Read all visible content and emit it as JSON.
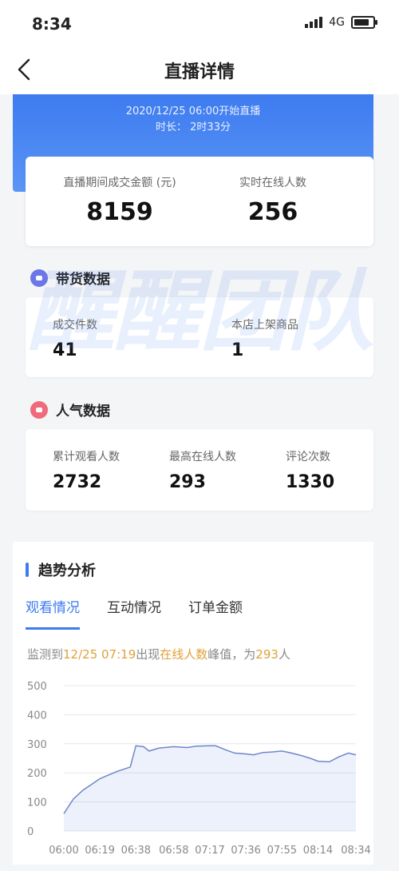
{
  "status": {
    "time": "8:34",
    "network": "4G"
  },
  "nav": {
    "title": "直播详情"
  },
  "banner": {
    "start": "2020/12/25 06:00开始直播",
    "duration": "时长： 2时33分"
  },
  "summary": {
    "gmv_label": "直播期间成交金额 (元)",
    "gmv_value": "8159",
    "online_label": "实时在线人数",
    "online_value": "256"
  },
  "goods": {
    "title": "带货数据",
    "orders_label": "成交件数",
    "orders_value": "41",
    "listed_label": "本店上架商品",
    "listed_value": "1"
  },
  "popularity": {
    "title": "人气数据",
    "viewers_label": "累计观看人数",
    "viewers_value": "2732",
    "peak_label": "最高在线人数",
    "peak_value": "293",
    "comments_label": "评论次数",
    "comments_value": "1330"
  },
  "trend": {
    "title": "趋势分析",
    "tabs": [
      "观看情况",
      "互动情况",
      "订单金额"
    ],
    "monitor": {
      "p1": "监测到",
      "time": "12/25 07:19",
      "p2": "出现",
      "metric": "在线人数",
      "p3": "峰值，为",
      "count": "293",
      "p4": "人"
    }
  },
  "watermark": "醒醒团队",
  "colors": {
    "accent": "#3d7bf0",
    "highlight": "#e0a13a"
  },
  "chart_data": {
    "type": "area",
    "x": [
      "06:00",
      "06:05",
      "06:10",
      "06:19",
      "06:28",
      "06:35",
      "06:38",
      "06:42",
      "06:45",
      "06:50",
      "06:58",
      "07:05",
      "07:10",
      "07:17",
      "07:20",
      "07:25",
      "07:30",
      "07:36",
      "07:40",
      "07:45",
      "07:50",
      "07:55",
      "08:00",
      "08:05",
      "08:10",
      "08:14",
      "08:20",
      "08:25",
      "08:30",
      "08:34"
    ],
    "values": [
      60,
      110,
      140,
      180,
      205,
      220,
      293,
      290,
      275,
      285,
      290,
      287,
      292,
      293,
      293,
      280,
      268,
      265,
      262,
      270,
      272,
      275,
      268,
      260,
      250,
      240,
      238,
      255,
      268,
      262
    ],
    "xticks": [
      "06:00",
      "06:19",
      "06:38",
      "06:58",
      "07:17",
      "07:36",
      "07:55",
      "08:14",
      "08:34"
    ],
    "yticks": [
      "0",
      "100",
      "200",
      "300",
      "400",
      "500"
    ],
    "ylim": [
      0,
      500
    ]
  }
}
